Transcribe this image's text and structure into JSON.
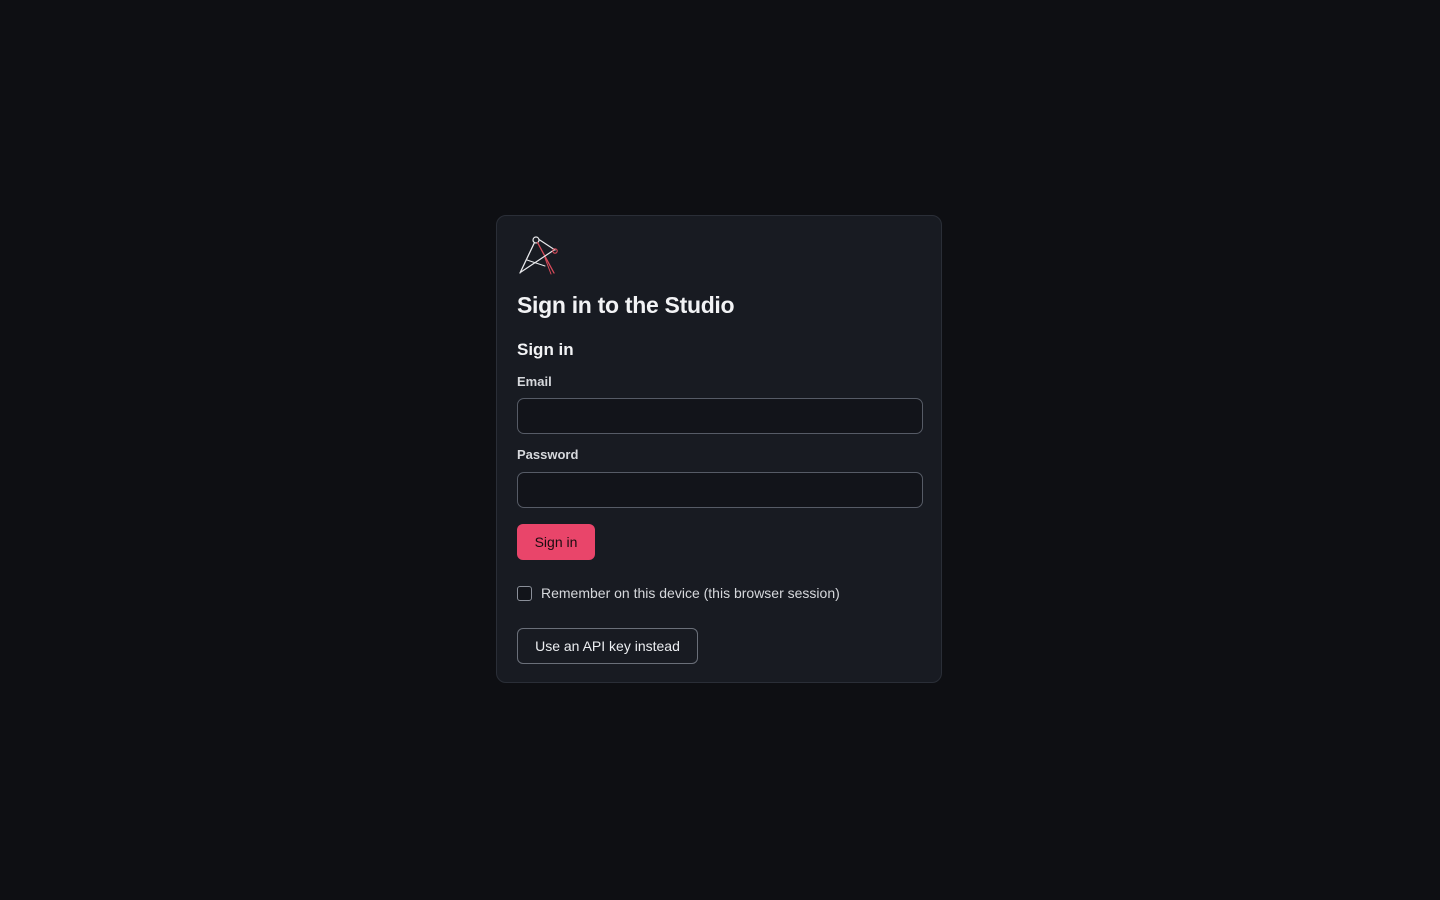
{
  "login": {
    "logo_icon": "compass-drafting-logo-icon",
    "title": "Sign in to the Studio",
    "subtitle": "Sign in",
    "email": {
      "label": "Email",
      "value": "",
      "placeholder": ""
    },
    "password": {
      "label": "Password",
      "value": "",
      "placeholder": ""
    },
    "submit_label": "Sign in",
    "remember": {
      "label": "Remember on this device (this browser session)",
      "checked": false
    },
    "api_key_label": "Use an API key instead"
  },
  "colors": {
    "background": "#0e0f13",
    "card": "#181b22",
    "accent": "#e9456a",
    "logo_accent": "#d94a5a"
  }
}
